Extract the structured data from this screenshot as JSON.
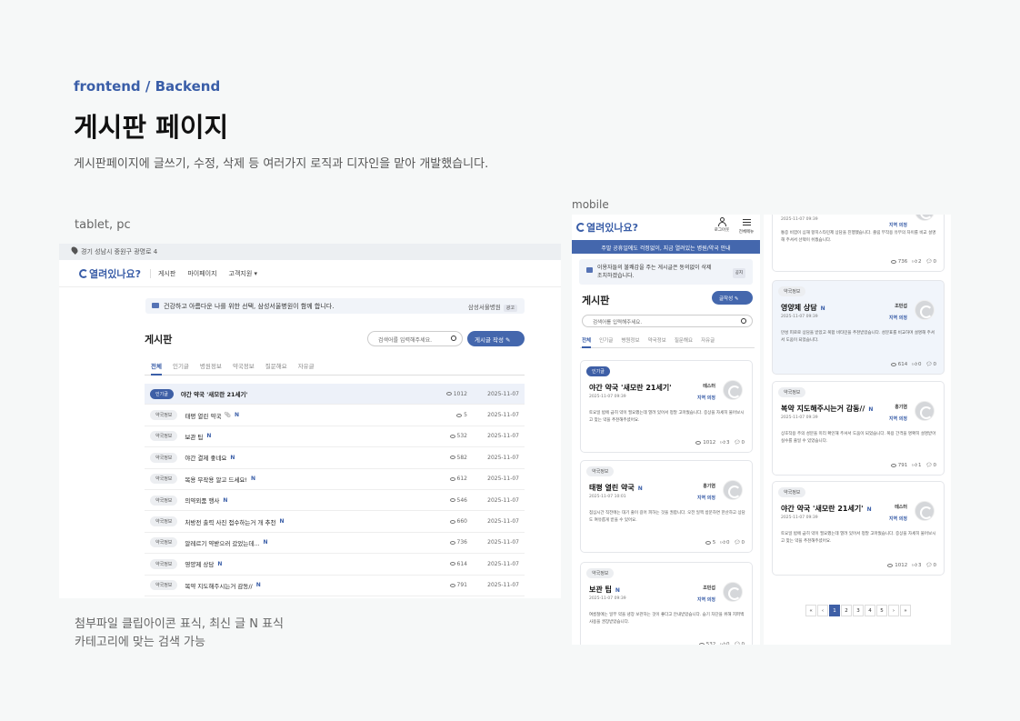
{
  "header": {
    "kicker": "frontend / Backend",
    "title": "게시판 페이지",
    "description": "게시판페이지에 글쓰기, 수정, 삭제 등 여러가지 로직과 디자인을 맡아 개발했습니다."
  },
  "labels": {
    "tablet": "tablet, pc",
    "mobile": "mobile"
  },
  "footer": {
    "line1": "첨부파일 클립아이콘 표식, 최신 글 N 표식",
    "line2": "카테고리에 맞는 검색 가능"
  },
  "brand": {
    "logo": "열려있나요?",
    "accent": "#3a5ea8"
  },
  "tablet": {
    "address": "경기 성남시 중원구 광명로 4",
    "menu": [
      "게시판",
      "마이페이지",
      "고객지원 ▾"
    ],
    "banner": "건강하고 아름다운 나를 위한 선택, 삼성서울병원이 함께 합니다.",
    "banner_sponsor": "삼성서울병원",
    "banner_ad": "광고",
    "heading": "게시판",
    "search_placeholder": "검색어를 입력해주세요.",
    "write_label": "게시글 작성",
    "tabs": [
      "전체",
      "인기글",
      "병원정보",
      "약국정보",
      "질문해요",
      "자유글"
    ],
    "rows": [
      {
        "cat": "인기글",
        "title": "야간 약국 '새모란 21세기'",
        "new": "",
        "views": "1012",
        "date": "2025-11-07"
      },
      {
        "cat": "약국정보",
        "title": "태평 열린 약국",
        "new": "N",
        "views": "5",
        "date": "2025-11-07"
      },
      {
        "cat": "약국정보",
        "title": "보관 팁",
        "new": "N",
        "views": "532",
        "date": "2025-11-07"
      },
      {
        "cat": "약국정보",
        "title": "야간 결제 좋네요",
        "new": "N",
        "views": "582",
        "date": "2025-11-07"
      },
      {
        "cat": "약국정보",
        "title": "복용 무작용 알고 드세요!",
        "new": "N",
        "views": "612",
        "date": "2025-11-07"
      },
      {
        "cat": "약국정보",
        "title": "의약외품 행사",
        "new": "N",
        "views": "546",
        "date": "2025-11-07"
      },
      {
        "cat": "약국정보",
        "title": "처방전 출력 사진 접수하는거 개 추천",
        "new": "N",
        "views": "660",
        "date": "2025-11-07"
      },
      {
        "cat": "약국정보",
        "title": "알레르기 약받으러 갔었는데...",
        "new": "N",
        "views": "736",
        "date": "2025-11-07"
      },
      {
        "cat": "약국정보",
        "title": "영양제 상담",
        "new": "N",
        "views": "614",
        "date": "2025-11-07"
      },
      {
        "cat": "약국정보",
        "title": "복약 지도해주시는거 감동//",
        "new": "N",
        "views": "791",
        "date": "2025-11-07"
      }
    ]
  },
  "mobile": {
    "login": "로그아웃",
    "menu_label": "전체메뉴",
    "notice": "주말 공휴일에도 걱정없이, 지금 열려있는 병원/약국 안내",
    "banner": "이용자들의 불쾌감을 주는 게시글은 동의없이 삭제 조치하겠습니다.",
    "banner_tag": "공지",
    "heading": "게시판",
    "write_label": "글작성",
    "search_placeholder": "검색어를 입력해주세요.",
    "tabs": [
      "전체",
      "인기글",
      "병원정보",
      "약국정보",
      "질문해요",
      "자유글"
    ],
    "cards": [
      {
        "cat": "인기글",
        "title": "야간 약국 '새모란 21세기'",
        "new": "",
        "author": "테스터",
        "badge": "지역 의정",
        "date": "2025-11-07 09:39",
        "text": "토요일 밤에 급히 약이 필요했는데 열려 있어서 정말 고마웠습니다. 증상을 자세히 물어보시고 맞는 약을 추천해주셨어요.",
        "views": "1012",
        "likes": "3",
        "comments": "0"
      },
      {
        "cat": "약국정보",
        "title": "태평 열린 약국",
        "new": "N",
        "author": "홍기염",
        "badge": "지역 의정",
        "date": "2025-11-07 10:01",
        "text": "점심시간 직전에는 대기 줄이 길어 피하는 것을 권합니다. 오전 일찍 방문하면 한산하고 상담도 여유롭게 받을 수 있어요.",
        "views": "5",
        "likes": "0",
        "comments": "0"
      },
      {
        "cat": "약국정보",
        "title": "보관 팁",
        "new": "N",
        "author": "조민섭",
        "badge": "지역 의정",
        "date": "2025-11-07 09:39",
        "text": "여름철에는 일부 약을 냉장 보관하는 것이 좋다고 안내받았습니다. 습기 차단을 위해 지퍼백 사용을 권장받았습니다.",
        "views": "532",
        "likes": "0",
        "comments": "0"
      }
    ]
  },
  "mobile2": {
    "top_date": "2025-11-07 09:39",
    "top_badge": "지역 의정",
    "top_text": "통증 비염이 심해 항히스타민제 상담을 진행했습니다. 졸림 부작용 유무의 차이를 비교 설명해 주셔서 선택이 쉬웠습니다.",
    "top_stats": {
      "views": "736",
      "likes": "2",
      "comments": "0"
    },
    "cards": [
      {
        "cat": "약국정보",
        "title": "영양제 상담",
        "new": "N",
        "author": "조민섭",
        "badge": "지역 의정",
        "date": "2025-11-07 09:39",
        "text": "만성 피로로 상담을 받았고 복합 비타민을 추천받았습니다. 성분표를 비교하며 설명해 주셔서 도움이 되었습니다.",
        "views": "614",
        "likes": "0",
        "comments": "0"
      },
      {
        "cat": "약국정보",
        "title": "복약 지도해주시는거 감동//",
        "new": "N",
        "author": "홍기염",
        "badge": "지역 의정",
        "date": "2025-11-07 09:39",
        "text": "상호작용 주의 성분을 미리 확인해 주셔서 도움이 되었습니다. 복용 간격을 명확히 설명받아 실수를 줄일 수 있었습니다.",
        "views": "791",
        "likes": "1",
        "comments": "0"
      },
      {
        "cat": "약국정보",
        "title": "야간 약국 '새모란 21세기'",
        "new": "N",
        "author": "테스터",
        "badge": "지역 의정",
        "date": "2025-11-07 09:39",
        "text": "토요일 밤에 급히 약이 필요했는데 열려 있어서 정말 고마웠습니다. 증상을 자세히 물어보시고 맞는 약을 추천해주셨어요.",
        "views": "1012",
        "likes": "3",
        "comments": "0"
      }
    ],
    "pages": [
      "«",
      "‹",
      "1",
      "2",
      "3",
      "4",
      "5",
      "›",
      "»"
    ],
    "current_page": "1"
  }
}
